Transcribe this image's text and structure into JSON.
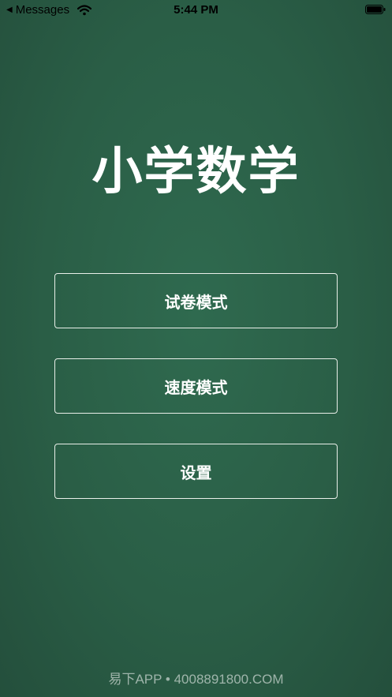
{
  "status_bar": {
    "back_label": "Messages",
    "time": "5:44 PM"
  },
  "app": {
    "title": "小学数学"
  },
  "menu": {
    "items": [
      {
        "label": "试卷模式"
      },
      {
        "label": "速度模式"
      },
      {
        "label": "设置"
      }
    ]
  },
  "footer": {
    "watermark": "易下APP • 4008891800.COM"
  },
  "colors": {
    "background": "#2a5e46",
    "button_border": "#e9efe9",
    "text": "#ffffff"
  }
}
